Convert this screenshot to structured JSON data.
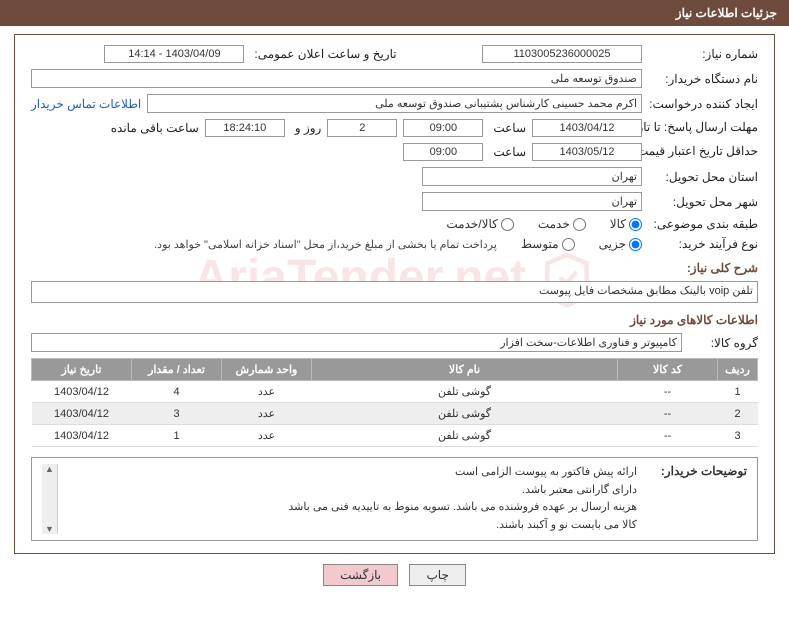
{
  "title": "جزئیات اطلاعات نیاز",
  "watermark": "AriaTender.net",
  "labels": {
    "req_no": "شماره نیاز:",
    "announce_dt": "تاریخ و ساعت اعلان عمومی:",
    "buyer_org": "نام دستگاه خریدار:",
    "requester": "ایجاد کننده درخواست:",
    "deadline": "مهلت ارسال پاسخ: تا تاریخ:",
    "saat": "ساعت",
    "rooz_va": "روز و",
    "remain": "ساعت باقی مانده",
    "validity": "حداقل تاریخ اعتبار قیمت: تا تاریخ:",
    "province": "استان محل تحویل:",
    "city": "شهر محل تحویل:",
    "category": "طبقه بندی موضوعی:",
    "process_type": "نوع فرآیند خرید:",
    "process_note": "پرداخت تمام یا بخشی از مبلغ خرید،از محل \"اسناد خزانه اسلامی\" خواهد بود.",
    "summary": "شرح کلی نیاز:",
    "items_heading": "اطلاعات کالاهای مورد نیاز",
    "item_group": "گروه کالا:",
    "buyer_notes": "توضیحات خریدار:",
    "contact": "اطلاعات تماس خریدار"
  },
  "values": {
    "req_no": "1103005236000025",
    "announce_dt": "1403/04/09 - 14:14",
    "buyer_org": "صندوق توسعه ملی",
    "requester": "اکرم محمد حسینی کارشناس پشتیبانی صندوق توسعه ملی",
    "deadline_date": "1403/04/12",
    "deadline_time": "09:00",
    "days_remain": "2",
    "time_remain": "18:24:10",
    "validity_date": "1403/05/12",
    "validity_time": "09:00",
    "province": "تهران",
    "city": "تهران",
    "summary": "تلفن voip بالینک مطابق مشخصات فایل پیوست",
    "item_group": "کامپیوتر و فناوری اطلاعات-سخت افزار"
  },
  "category_opts": {
    "goods": "کالا",
    "service": "خدمت",
    "both": "کالا/خدمت"
  },
  "process_opts": {
    "partial": "جزیی",
    "medium": "متوسط"
  },
  "table": {
    "headers": {
      "row": "ردیف",
      "code": "کد کالا",
      "name": "نام کالا",
      "unit": "واحد شمارش",
      "qty": "تعداد / مقدار",
      "need_date": "تاریخ نیاز"
    },
    "rows": [
      {
        "row": "1",
        "code": "--",
        "name": "گوشی تلفن",
        "unit": "عدد",
        "qty": "4",
        "need_date": "1403/04/12"
      },
      {
        "row": "2",
        "code": "--",
        "name": "گوشی تلفن",
        "unit": "عدد",
        "qty": "3",
        "need_date": "1403/04/12"
      },
      {
        "row": "3",
        "code": "--",
        "name": "گوشی تلفن",
        "unit": "عدد",
        "qty": "1",
        "need_date": "1403/04/12"
      }
    ]
  },
  "buyer_notes": [
    "ارائه پیش فاکتور به پیوست الزامی است",
    "دارای گارانتی معتبر باشد.",
    "هزینه ارسال بر عهده فروشنده می باشد. تسویه منوط به تاییدیه فنی می باشد",
    "کالا می بایست نو و آکبند باشند."
  ],
  "buttons": {
    "print": "چاپ",
    "back": "بازگشت"
  }
}
